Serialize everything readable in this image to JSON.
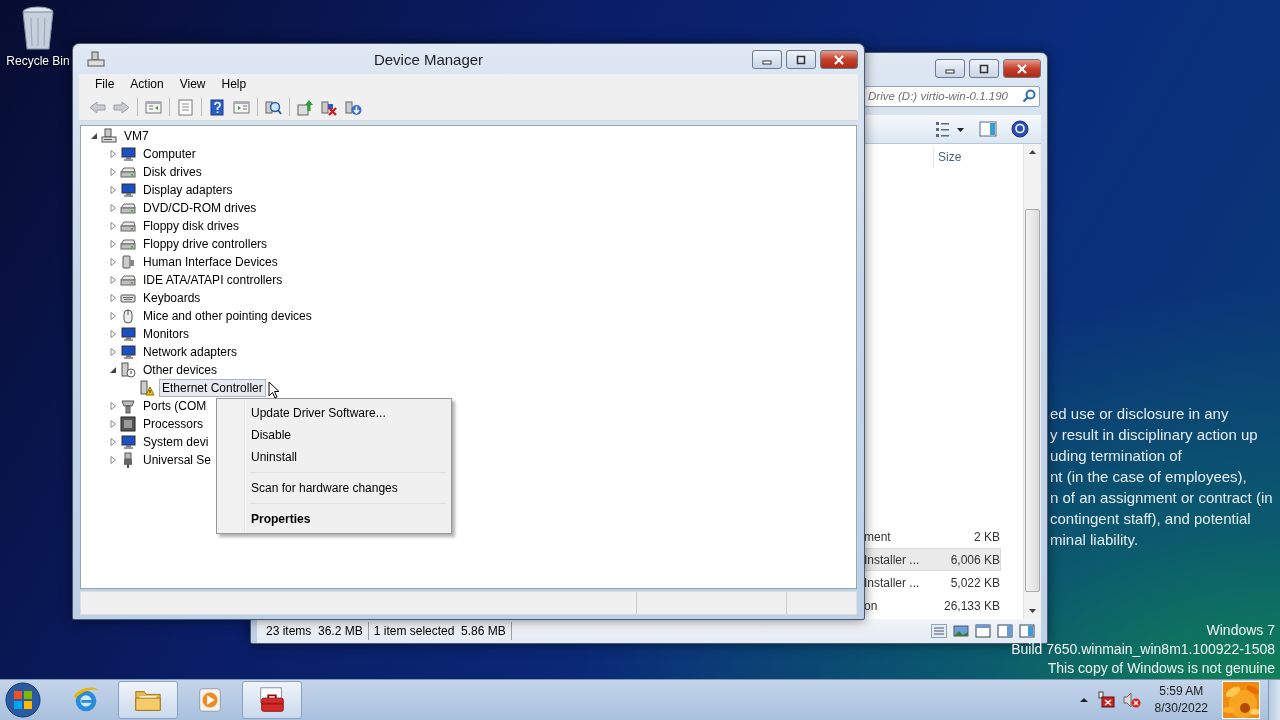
{
  "desktop": {
    "recycle_bin": {
      "label": "Recycle Bin"
    },
    "notice_lines": [
      "ed use or disclosure in any",
      "y result in disciplinary action up",
      "uding termination of",
      "nt (in the case of employees),",
      "n of an assignment or contract (in",
      "contingent staff), and potential",
      "minal liability."
    ],
    "watermark": [
      "Windows 7",
      "Build 7650.winmain_win8m1.100922-1508",
      "This copy of Windows is not genuine"
    ]
  },
  "explorer": {
    "search": {
      "placeholder": "Drive (D:) virtio-win-0.1.190"
    },
    "columns": [
      "Size"
    ],
    "rows": [
      {
        "type": "ment",
        "size": "2 KB",
        "selected": false
      },
      {
        "type": "Installer ...",
        "size": "6,006 KB",
        "selected": true
      },
      {
        "type": "Installer ...",
        "size": "5,022 KB",
        "selected": false
      },
      {
        "type": "on",
        "size": "26,133 KB",
        "selected": false
      }
    ],
    "status": [
      "23 items  36.2 MB",
      "1 item selected  5.86 MB"
    ]
  },
  "device_manager": {
    "title": "Device Manager",
    "menu": [
      "File",
      "Action",
      "View",
      "Help"
    ],
    "tree": {
      "root": {
        "label": "VM7",
        "kind": "server",
        "expanded": true,
        "selected": false,
        "children": [
          {
            "label": "Computer",
            "kind": "monitor",
            "expanded": false,
            "selected": false
          },
          {
            "label": "Disk drives",
            "kind": "drive",
            "expanded": false,
            "selected": false
          },
          {
            "label": "Display adapters",
            "kind": "monitor",
            "expanded": false,
            "selected": false
          },
          {
            "label": "DVD/CD-ROM drives",
            "kind": "drive",
            "expanded": false,
            "selected": false
          },
          {
            "label": "Floppy disk drives",
            "kind": "drive",
            "expanded": false,
            "selected": false
          },
          {
            "label": "Floppy drive controllers",
            "kind": "drive",
            "expanded": false,
            "selected": false
          },
          {
            "label": "Human Interface Devices",
            "kind": "device",
            "expanded": false,
            "selected": false
          },
          {
            "label": "IDE ATA/ATAPI controllers",
            "kind": "drive",
            "expanded": false,
            "selected": false
          },
          {
            "label": "Keyboards",
            "kind": "keyboard",
            "expanded": false,
            "selected": false
          },
          {
            "label": "Mice and other pointing devices",
            "kind": "mouse",
            "expanded": false,
            "selected": false
          },
          {
            "label": "Monitors",
            "kind": "monitor",
            "expanded": false,
            "selected": false
          },
          {
            "label": "Network adapters",
            "kind": "monitor",
            "expanded": false,
            "selected": false
          },
          {
            "label": "Other devices",
            "kind": "unknown",
            "expanded": true,
            "selected": false,
            "children": [
              {
                "label": "Ethernet Controller",
                "kind": "warning",
                "selected": true
              }
            ]
          },
          {
            "label": "Ports (COM",
            "kind": "port",
            "expanded": false,
            "selected": false
          },
          {
            "label": "Processors",
            "kind": "chip",
            "expanded": false,
            "selected": false
          },
          {
            "label": "System devi",
            "kind": "monitor",
            "expanded": false,
            "selected": false
          },
          {
            "label": "Universal Se",
            "kind": "usb",
            "expanded": false,
            "selected": false
          }
        ]
      }
    }
  },
  "context_menu": {
    "items": [
      {
        "kind": "item",
        "label": "Update Driver Software...",
        "default": false
      },
      {
        "kind": "item",
        "label": "Disable",
        "default": false
      },
      {
        "kind": "item",
        "label": "Uninstall",
        "default": false
      },
      {
        "kind": "separator"
      },
      {
        "kind": "item",
        "label": "Scan for hardware changes",
        "default": false
      },
      {
        "kind": "separator"
      },
      {
        "kind": "item",
        "label": "Properties",
        "default": true
      }
    ]
  },
  "taskbar": {
    "items": [
      {
        "kind": "browser",
        "running": false
      },
      {
        "kind": "folder",
        "running": true
      },
      {
        "kind": "media",
        "running": false
      },
      {
        "kind": "toolbox",
        "running": true
      }
    ],
    "clock": {
      "time": "5:59 AM",
      "date": "8/30/2022"
    }
  }
}
